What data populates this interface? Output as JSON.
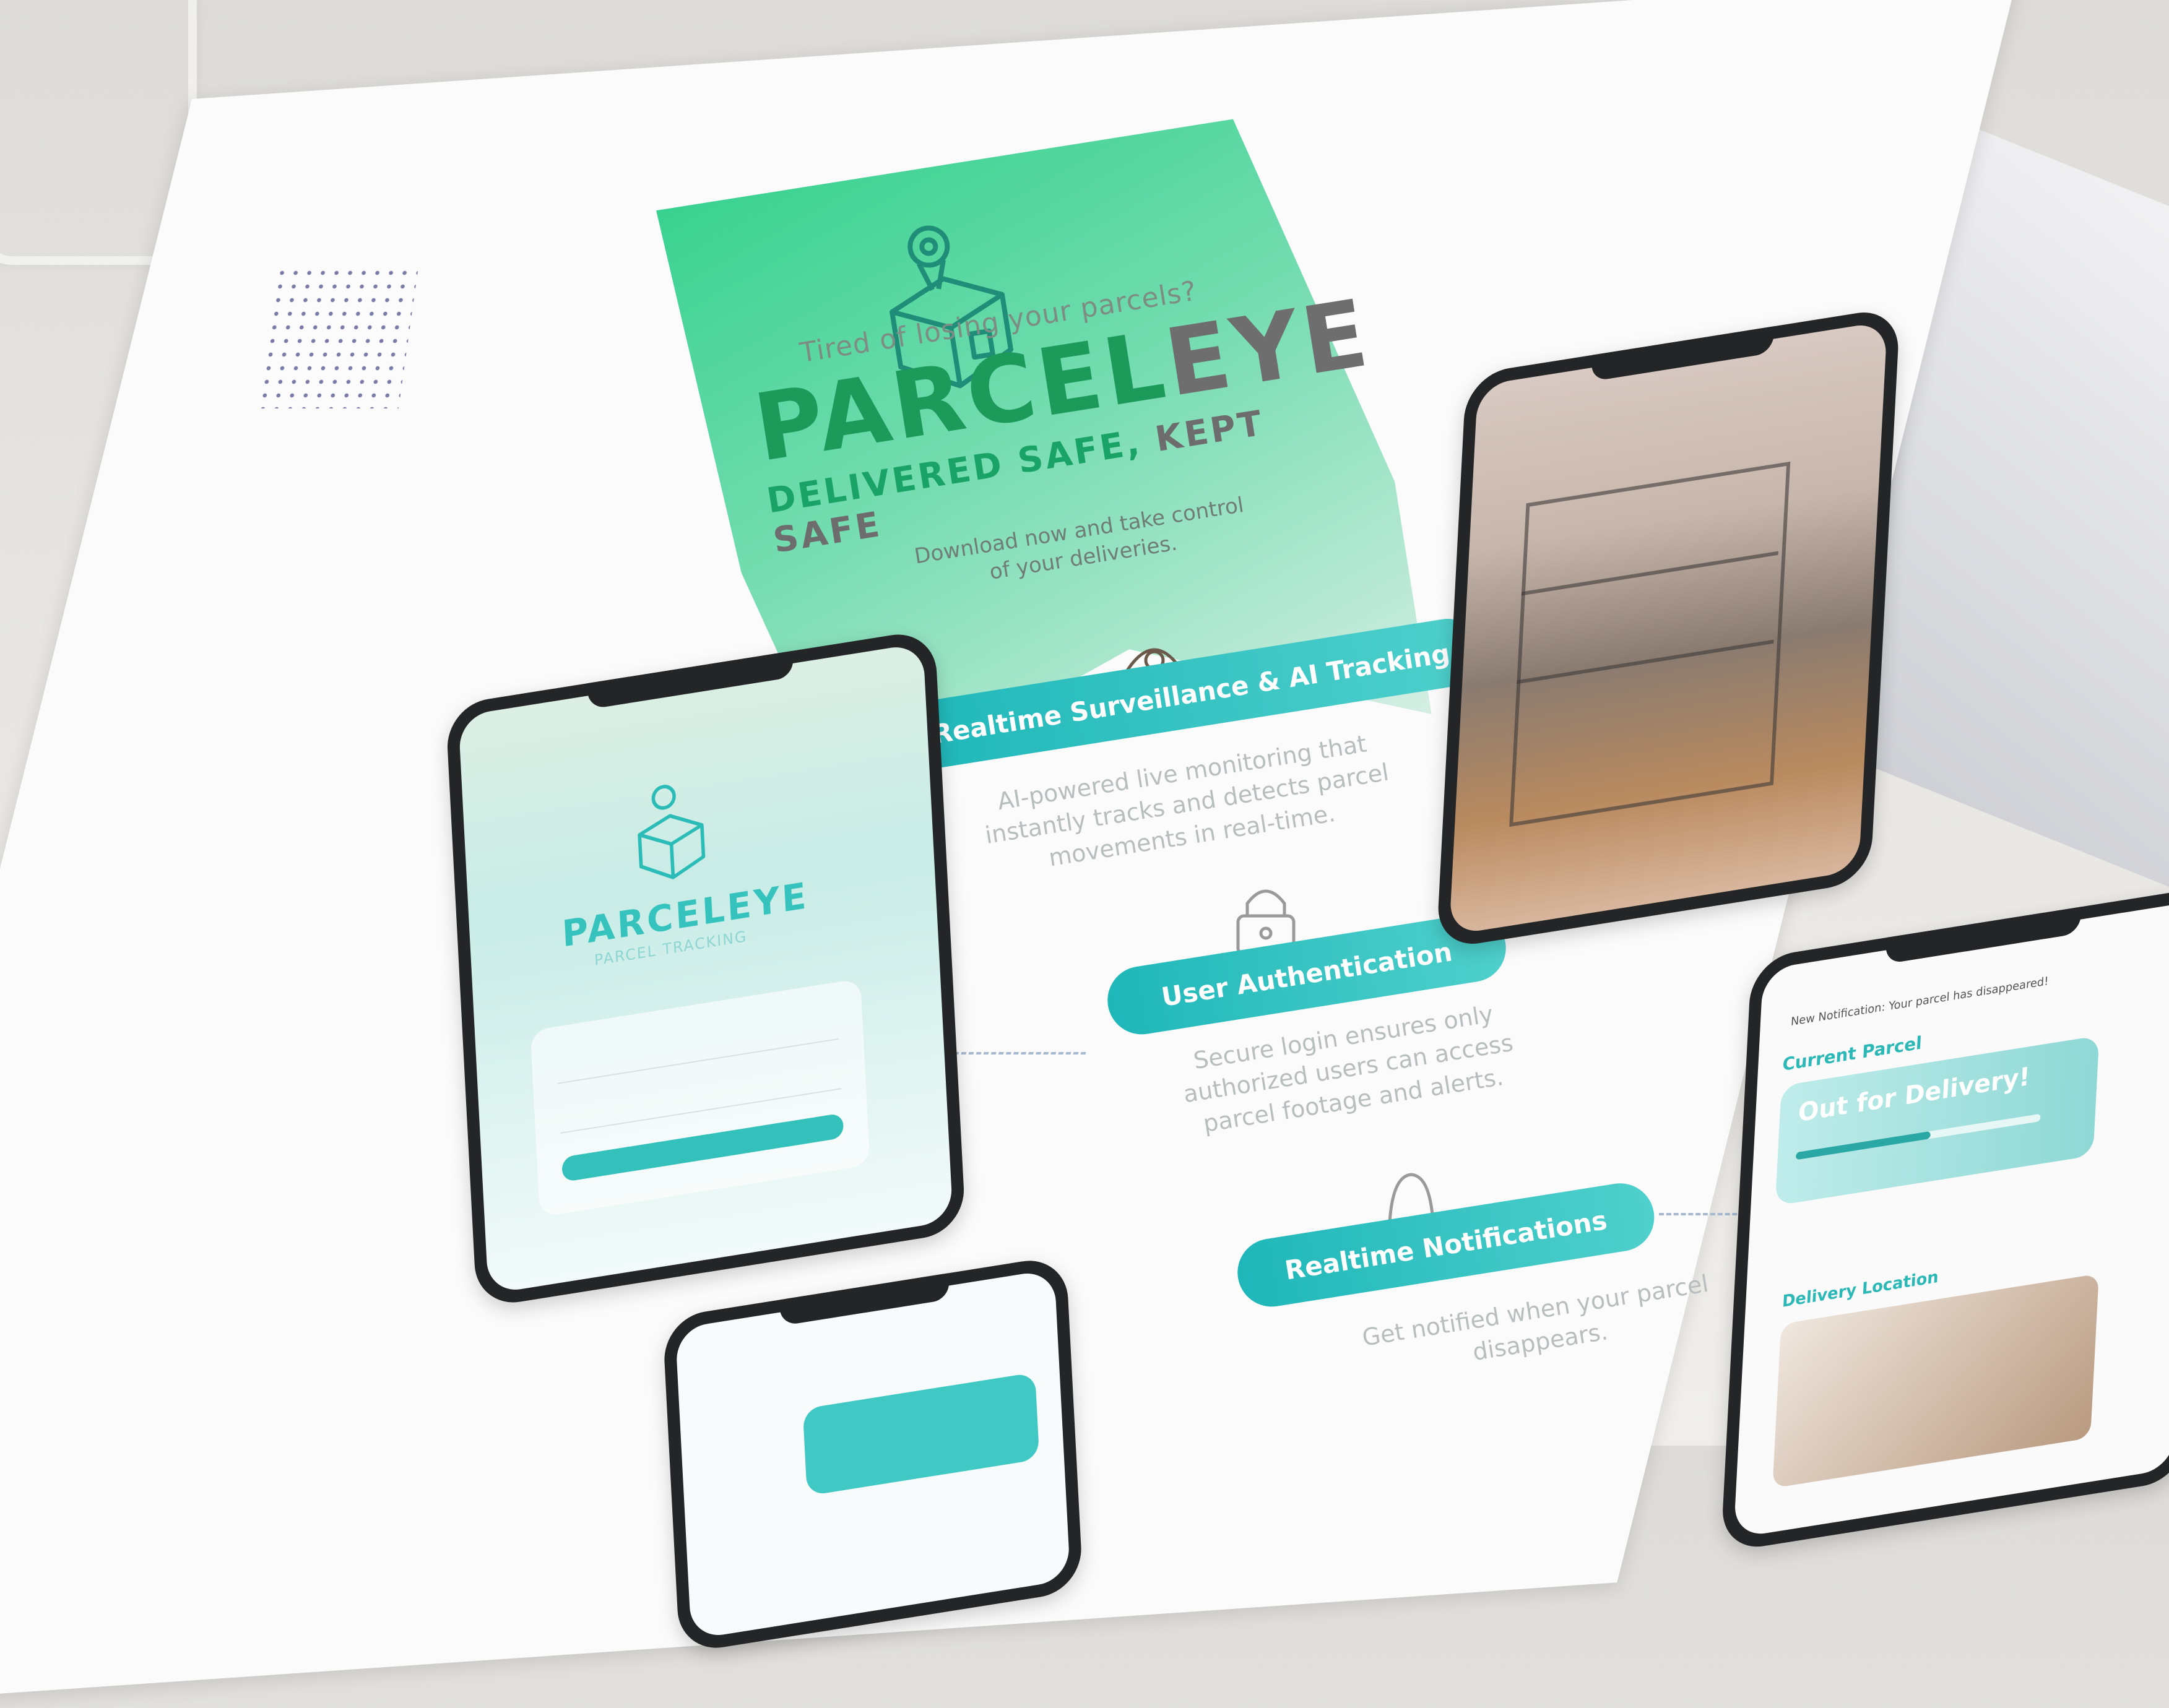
{
  "poster": {
    "tagline": "Tired of losing your parcels?",
    "brand_part1": "PARCEL",
    "brand_part2": "EYE",
    "slogan_part1": "DELIVERED SAFE,",
    "slogan_part2": " KEPT SAFE",
    "cta_line1": "Download now and take control",
    "cta_line2": "of your deliveries."
  },
  "features": [
    {
      "title": "Realtime Surveillance & AI Tracking",
      "description": "AI-powered live monitoring that instantly tracks and detects parcel movements in real-time.",
      "icon": "camera-icon"
    },
    {
      "title": "User Authentication",
      "description": "Secure login ensures only authorized users can access parcel footage and alerts.",
      "icon": "lock-icon"
    },
    {
      "title": "Realtime Notifications",
      "description": "Get notified when your parcel disappears.",
      "icon": "bell-icon"
    }
  ],
  "phones": {
    "login": {
      "brand": "PARCELEYE",
      "subtitle": "PARCEL TRACKING"
    },
    "dashboard": {
      "notification": "New Notification: Your parcel has disappeared!",
      "current_parcel": "Current Parcel",
      "status": "Out for Delivery!",
      "delivery_location": "Delivery Location"
    }
  },
  "colors": {
    "brand_green": "#1b9a5a",
    "teal": "#1fb7b9",
    "gray": "#6e6e6e"
  }
}
